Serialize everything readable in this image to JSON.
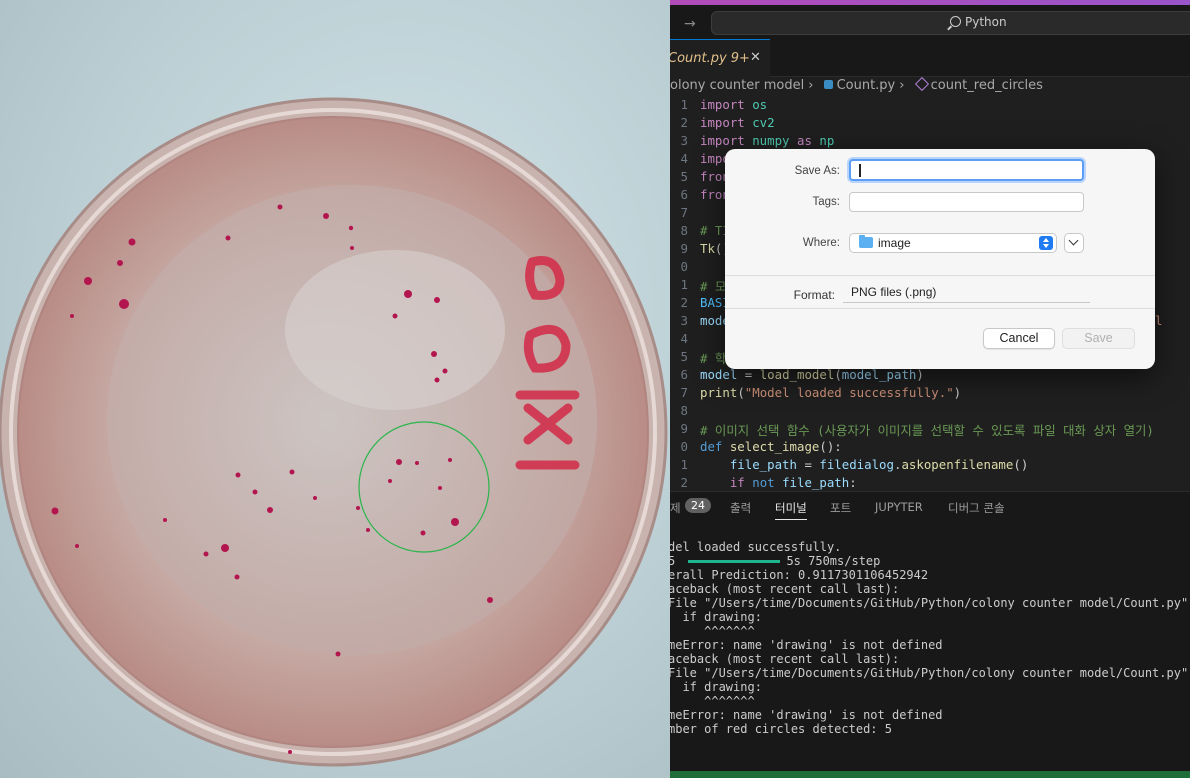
{
  "title_bar": {
    "search_text": "Python"
  },
  "tab": {
    "name": "Count.py",
    "problems": "9+"
  },
  "breadcrumbs": [
    "olony counter model",
    "Count.py",
    "count_red_circles"
  ],
  "code_lines": [
    {
      "n": "1",
      "tokens": [
        [
          "kw",
          "import "
        ],
        [
          "mod",
          "os"
        ]
      ]
    },
    {
      "n": "2",
      "tokens": [
        [
          "kw",
          "import "
        ],
        [
          "mod",
          "cv2"
        ]
      ]
    },
    {
      "n": "3",
      "tokens": [
        [
          "kw",
          "import "
        ],
        [
          "mod",
          "numpy"
        ],
        [
          "kw",
          " as "
        ],
        [
          "mod",
          "np"
        ]
      ]
    },
    {
      "n": "4",
      "tokens": [
        [
          "kw",
          "impo"
        ]
      ]
    },
    {
      "n": "5",
      "tokens": [
        [
          "kw",
          "fron"
        ]
      ]
    },
    {
      "n": "6",
      "tokens": [
        [
          "kw",
          "fron"
        ]
      ]
    },
    {
      "n": "7",
      "tokens": []
    },
    {
      "n": "8",
      "tokens": [
        [
          "cm",
          "# TI"
        ]
      ]
    },
    {
      "n": "9",
      "tokens": [
        [
          "fn",
          "Tk"
        ],
        [
          "",
          "()"
        ]
      ]
    },
    {
      "n": "0",
      "tokens": []
    },
    {
      "n": "1",
      "tokens": [
        [
          "cm",
          "# 모"
        ]
      ]
    },
    {
      "n": "2",
      "tokens": [
        [
          "cst",
          "BASI"
        ]
      ]
    },
    {
      "n": "3",
      "tokens": [
        [
          "var",
          "mode"
        ],
        [
          "",
          "                                                     "
        ],
        [
          "str",
          "l/col"
        ]
      ]
    },
    {
      "n": "4",
      "tokens": []
    },
    {
      "n": "5",
      "tokens": [
        [
          "cm",
          "# 학"
        ]
      ]
    },
    {
      "n": "6",
      "tokens": [
        [
          "var",
          "model"
        ],
        [
          "",
          " = "
        ],
        [
          "fn",
          "load_model"
        ],
        [
          "",
          "("
        ],
        [
          "var",
          "model_path"
        ],
        [
          "",
          ")"
        ]
      ]
    },
    {
      "n": "7",
      "tokens": [
        [
          "fn",
          "print"
        ],
        [
          "",
          "("
        ],
        [
          "str",
          "\"Model loaded successfully.\""
        ],
        [
          "",
          ")"
        ]
      ]
    },
    {
      "n": "8",
      "tokens": []
    },
    {
      "n": "9",
      "tokens": [
        [
          "cm",
          "# 이미지 선택 함수 (사용자가 이미지를 선택할 수 있도록 파일 대화 상자 열기)"
        ]
      ]
    },
    {
      "n": "0",
      "tokens": [
        [
          "kwb",
          "def "
        ],
        [
          "fn",
          "select_image"
        ],
        [
          "",
          "():"
        ]
      ]
    },
    {
      "n": "1",
      "tokens": [
        [
          "",
          "    "
        ],
        [
          "var",
          "file_path"
        ],
        [
          "",
          " = "
        ],
        [
          "var",
          "filedialog"
        ],
        [
          "",
          "."
        ],
        [
          "fn",
          "askopenfilename"
        ],
        [
          "",
          "()"
        ]
      ]
    },
    {
      "n": "2",
      "tokens": [
        [
          "",
          "    "
        ],
        [
          "kw",
          "if "
        ],
        [
          "kwb",
          "not "
        ],
        [
          "var",
          "file_path"
        ],
        [
          "",
          ":"
        ]
      ]
    }
  ],
  "panel_tabs": {
    "problems_cut": "제",
    "problems_count": "24",
    "output": "출력",
    "terminal": "터미널",
    "ports": "포트",
    "jupyter": "JUPYTER",
    "debug_console": "디버그 콘솔"
  },
  "terminal_lines": [
    "del loaded successfully.",
    "5 ",
    "erall Prediction: 0.9117301106452942",
    "aceback (most recent call last):",
    "File \"/Users/time/Documents/GitHub/Python/colony counter model/Count.py\", l",
    "  if drawing:",
    "     ^^^^^^^",
    "meError: name 'drawing' is not defined",
    "aceback (most recent call last):",
    "File \"/Users/time/Documents/GitHub/Python/colony counter model/Count.py\", l",
    "  if drawing:",
    "     ^^^^^^^",
    "meError: name 'drawing' is not defined",
    "mber of red circles detected: 5"
  ],
  "progress_step": "5s 750ms/step",
  "dialog": {
    "save_as_label": "Save As:",
    "save_as_value": "",
    "tags_label": "Tags:",
    "where_label": "Where:",
    "where_value": "image",
    "format_label": "Format:",
    "format_value": "PNG files (.png)",
    "cancel": "Cancel",
    "save": "Save"
  },
  "photo": {
    "dish_label": "1x10"
  }
}
